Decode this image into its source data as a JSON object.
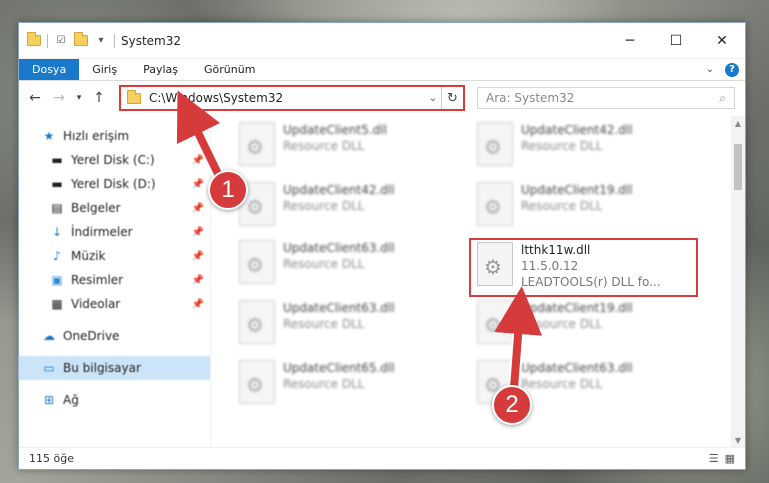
{
  "window": {
    "title": "System32"
  },
  "ribbon": {
    "tabs": [
      "Dosya",
      "Giriş",
      "Paylaş",
      "Görünüm"
    ]
  },
  "address": {
    "path": "C:\\Windows\\System32"
  },
  "search": {
    "placeholder": "Ara: System32"
  },
  "sidebar": {
    "quick_access": "Hızlı erişim",
    "items": [
      {
        "label": "Yerel Disk (C:)",
        "icon": "drive-icon"
      },
      {
        "label": "Yerel Disk (D:)",
        "icon": "drive-icon"
      },
      {
        "label": "Belgeler",
        "icon": "documents-icon"
      },
      {
        "label": "İndirmeler",
        "icon": "downloads-icon"
      },
      {
        "label": "Müzik",
        "icon": "music-icon"
      },
      {
        "label": "Resimler",
        "icon": "pictures-icon"
      },
      {
        "label": "Videolar",
        "icon": "videos-icon"
      }
    ],
    "onedrive": "OneDrive",
    "this_pc": "Bu bilgisayar",
    "network": "Ağ"
  },
  "files": [
    {
      "name": "UpdateClient5.dll",
      "type": "Resource DLL"
    },
    {
      "name": "UpdateClient42.dll",
      "type": "Resource DLL"
    },
    {
      "name": "UpdateClient42.dll",
      "type": "Resource DLL"
    },
    {
      "name": "UpdateClient19.dll",
      "type": "Resource DLL"
    },
    {
      "name": "UpdateClient63.dll",
      "type": "Resource DLL"
    },
    {
      "name": "ltthk11w.dll",
      "version": "11.5.0.12",
      "description": "LEADTOOLS(r) DLL fo..."
    },
    {
      "name": "UpdateClient63.dll",
      "type": "Resource DLL"
    },
    {
      "name": "UpdateClient19.dll",
      "type": "Resource DLL"
    },
    {
      "name": "UpdateClient65.dll",
      "type": "Resource DLL"
    },
    {
      "name": "UpdateClient63.dll",
      "type": "Resource DLL"
    }
  ],
  "status": {
    "count": "115 öğe"
  },
  "callouts": [
    "1",
    "2"
  ],
  "colors": {
    "accent": "#1979ca",
    "highlight": "#d93a3a",
    "selected": "#cce4f7"
  }
}
